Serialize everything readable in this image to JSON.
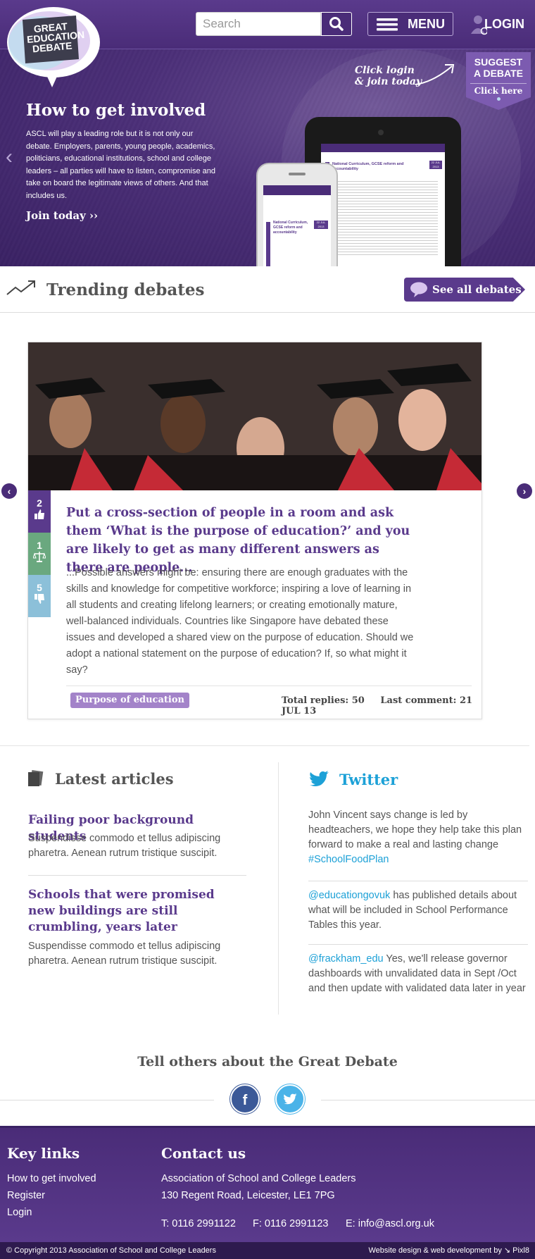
{
  "header": {
    "logo_text": "GREAT EDUCATION DEBATE",
    "search_placeholder": "Search",
    "menu_label": "MENU",
    "login_label": "LOGIN"
  },
  "hero": {
    "suggest_line1": "SUGGEST",
    "suggest_line2": "A DEBATE",
    "suggest_cta": "Click here",
    "click_login_line1": "Click login",
    "click_login_line2": "& join today",
    "title": "How to get involved",
    "text": "ASCL will play a leading role but it is not only our debate. Employers, parents, young people, academics, politicians, educational institutions, school and college leaders – all parties will have to listen, compromise and take on board the legitimate views of others. And that includes us.",
    "join": "Join today ››",
    "tablet_title": "National Curriculum, GCSE reform and accountability",
    "tablet_date": "22 JUL 2013",
    "phone_title": "National Curriculum, GCSE reform and accountability",
    "phone_date": "22 JUL 2013"
  },
  "trending": {
    "title": "Trending debates",
    "see_all": "See all debates"
  },
  "debate": {
    "votes_up": "2",
    "votes_neutral": "1",
    "votes_down": "5",
    "title": "Put a cross-section of people in a room and ask them ‘What is the purpose of education?’ and you are likely to get as many different answers as there are people...",
    "body": "...Possible answers might be: ensuring there are enough graduates with the skills and knowledge for competitive workforce; inspiring a love of learning in all students and creating lifelong learners; or creating emotionally mature, well-balanced individuals. Countries like Singapore have debated these issues and developed a shared view on the purpose of education. Should we adopt a national statement on the purpose of education? If, so what might it say?",
    "tag": "Purpose of education",
    "replies": "Total replies: 50",
    "last_comment": "Last comment: 21 JUL 13"
  },
  "articles": {
    "title": "Latest articles",
    "items": [
      {
        "title": "Failing poor background students",
        "text": "Suspendisse commodo et tellus adipiscing pharetra. Aenean rutrum tristique suscipit."
      },
      {
        "title": "Schools that were promised new buildings are still crumbling, years later",
        "text": "Suspendisse commodo et tellus adipiscing pharetra. Aenean rutrum tristique suscipit."
      }
    ]
  },
  "twitter": {
    "title": "Twitter",
    "tweets": [
      {
        "pre": "John Vincent says change is led by headteachers, we hope they help take this plan forward to make a real and lasting change ",
        "link": "#SchoolFoodPlan",
        "post": ""
      },
      {
        "pre": "",
        "link": "@educationgovuk",
        "post": " has published details about what will be included in School Performance Tables this year."
      },
      {
        "pre": "",
        "link": "@frackham_edu",
        "post": " Yes, we'll release governor dashboards with unvalidated data in Sept /Oct and then update with validated data later in year"
      }
    ]
  },
  "share": {
    "title": "Tell others about the Great Debate",
    "facebook": "f",
    "twitter": "t"
  },
  "footer": {
    "key_links_title": "Key links",
    "links": [
      "How to get involved",
      "Register",
      "Login"
    ],
    "contact_title": "Contact us",
    "org": "Association of School and College Leaders",
    "address": "130 Regent Road, Leicester, LE1 7PG",
    "tel": "T: 0116 2991122",
    "fax": "F: 0116 2991123",
    "email": "E: info@ascl.org.uk",
    "copyright": "© Copyright 2013 Association of School and College Leaders",
    "credit": "Website design & web development by ↘ Pixl8"
  },
  "colors": {
    "brand_purple": "#4a2c78",
    "link_purple": "#5a3a8c",
    "twitter_blue": "#1da1d7",
    "vote_up": "#5a3a8c",
    "vote_neutral": "#6aa87f",
    "vote_down": "#8cc0d9"
  }
}
